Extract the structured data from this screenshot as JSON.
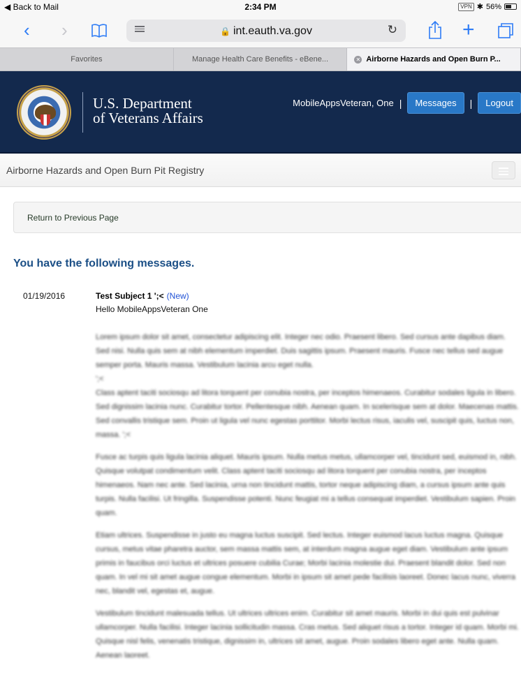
{
  "status_bar": {
    "back_label": "◀ Back to Mail",
    "time": "2:34 PM",
    "vpn": "VPN",
    "bluetooth": "✱",
    "battery_text": "56%",
    "battery_level": 0.56
  },
  "toolbar": {
    "url": "int.eauth.va.gov",
    "icons": [
      "back-icon",
      "forward-icon",
      "bookmarks-icon",
      "reader-icon",
      "reload-icon",
      "share-icon",
      "new-tab-icon",
      "tabs-icon"
    ]
  },
  "tabs": [
    {
      "label": "Favorites",
      "active": false
    },
    {
      "label": "Manage Health Care Benefits - eBene...",
      "active": false
    },
    {
      "label": "Airborne Hazards and Open Burn P...",
      "active": true
    }
  ],
  "header": {
    "brand_line1": "U.S. Department",
    "brand_line2": "of Veterans Affairs",
    "user_name": "MobileAppsVeteran, One",
    "separator": "|",
    "messages_button": "Messages",
    "logout_button": "Logout"
  },
  "subnav": {
    "title": "Airborne Hazards and Open Burn Pit Registry"
  },
  "return_link": "Return to Previous Page",
  "page_heading": "You have the following messages.",
  "message": {
    "date": "01/19/2016",
    "subject": "Test Subject 1 ';<",
    "new_label": "(New)",
    "greeting": "Hello MobileAppsVeteran One",
    "paragraphs": [
      "Lorem ipsum dolor sit amet, consectetur adipiscing elit. Integer nec odio. Praesent libero. Sed cursus ante dapibus diam. Sed nisi. Nulla quis sem at nibh elementum imperdiet. Duis sagittis ipsum. Praesent mauris. Fusce nec tellus sed augue semper porta. Mauris massa. Vestibulum lacinia arcu eget nulla.",
      "';<",
      "Class aptent taciti sociosqu ad litora torquent per conubia nostra, per inceptos himenaeos. Curabitur sodales ligula in libero. Sed dignissim lacinia nunc. Curabitur tortor. Pellentesque nibh. Aenean quam. In scelerisque sem at dolor. Maecenas mattis. Sed convallis tristique sem. Proin ut ligula vel nunc egestas porttitor. Morbi lectus risus, iaculis vel, suscipit quis, luctus non, massa. ';<",
      "Fusce ac turpis quis ligula lacinia aliquet. Mauris ipsum. Nulla metus metus, ullamcorper vel, tincidunt sed, euismod in, nibh. Quisque volutpat condimentum velit. Class aptent taciti sociosqu ad litora torquent per conubia nostra, per inceptos himenaeos. Nam nec ante. Sed lacinia, urna non tincidunt mattis, tortor neque adipiscing diam, a cursus ipsum ante quis turpis. Nulla facilisi. Ut fringilla. Suspendisse potenti. Nunc feugiat mi a tellus consequat imperdiet. Vestibulum sapien. Proin quam.",
      "Etiam ultrices. Suspendisse in justo eu magna luctus suscipit. Sed lectus. Integer euismod lacus luctus magna. Quisque cursus, metus vitae pharetra auctor, sem massa mattis sem, at interdum magna augue eget diam. Vestibulum ante ipsum primis in faucibus orci luctus et ultrices posuere cubilia Curae; Morbi lacinia molestie dui. Praesent blandit dolor. Sed non quam. In vel mi sit amet augue congue elementum. Morbi in ipsum sit amet pede facilisis laoreet. Donec lacus nunc, viverra nec, blandit vel, egestas et, augue.",
      "Vestibulum tincidunt malesuada tellus. Ut ultrices ultrices enim. Curabitur sit amet mauris. Morbi in dui quis est pulvinar ullamcorper. Nulla facilisi. Integer lacinia sollicitudin massa. Cras metus. Sed aliquet risus a tortor. Integer id quam. Morbi mi. Quisque nisl felis, venenatis tristique, dignissim in, ultrices sit amet, augue. Proin sodales libero eget ante. Nulla quam. Aenean laoreet."
    ]
  }
}
